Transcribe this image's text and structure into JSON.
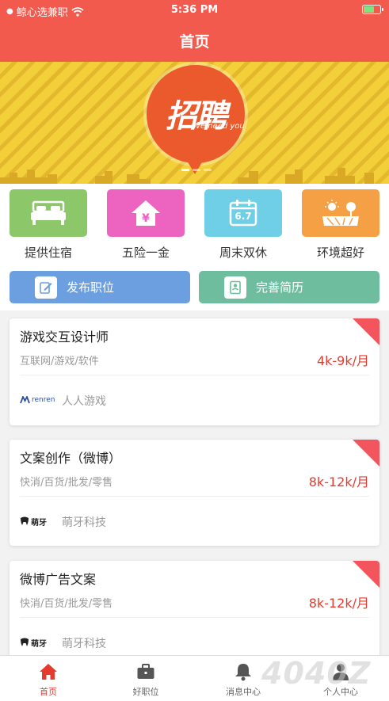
{
  "status_bar": {
    "carrier": "鲸心选兼职",
    "time": "5:36 PM"
  },
  "header": {
    "title": "首页"
  },
  "banner": {
    "headline": "招聘",
    "sub": "We need you"
  },
  "benefits": [
    {
      "label": "提供住宿",
      "color": "#8cc86a",
      "icon": "bed-icon"
    },
    {
      "label": "五险一金",
      "color": "#ec63c0",
      "icon": "house-yen-icon"
    },
    {
      "label": "周末双休",
      "color": "#6fcfe6",
      "icon": "calendar-icon",
      "date": "6.7"
    },
    {
      "label": "环境超好",
      "color": "#f5a045",
      "icon": "landscape-icon"
    }
  ],
  "actions": [
    {
      "label": "发布职位",
      "color": "#6c9fdf"
    },
    {
      "label": "完善简历",
      "color": "#6ebd9f"
    }
  ],
  "jobs": [
    {
      "title": "游戏交互设计师",
      "category": "互联网/游戏/软件",
      "salary": "4k-9k/月",
      "company": "人人游戏",
      "logo": "renren"
    },
    {
      "title": "文案创作（微博）",
      "category": "快消/百货/批发/零售",
      "salary": "8k-12k/月",
      "company": "萌牙科技",
      "logo": "萌牙"
    },
    {
      "title": "微博广告文案",
      "category": "快消/百货/批发/零售",
      "salary": "8k-12k/月",
      "company": "萌牙科技",
      "logo": "萌牙"
    }
  ],
  "tabs": [
    {
      "label": "首页",
      "icon": "home-icon",
      "active": true
    },
    {
      "label": "好职位",
      "icon": "briefcase-icon"
    },
    {
      "label": "消息中心",
      "icon": "bell-icon"
    },
    {
      "label": "个人中心",
      "icon": "person-icon"
    }
  ],
  "watermark": "4040Z"
}
